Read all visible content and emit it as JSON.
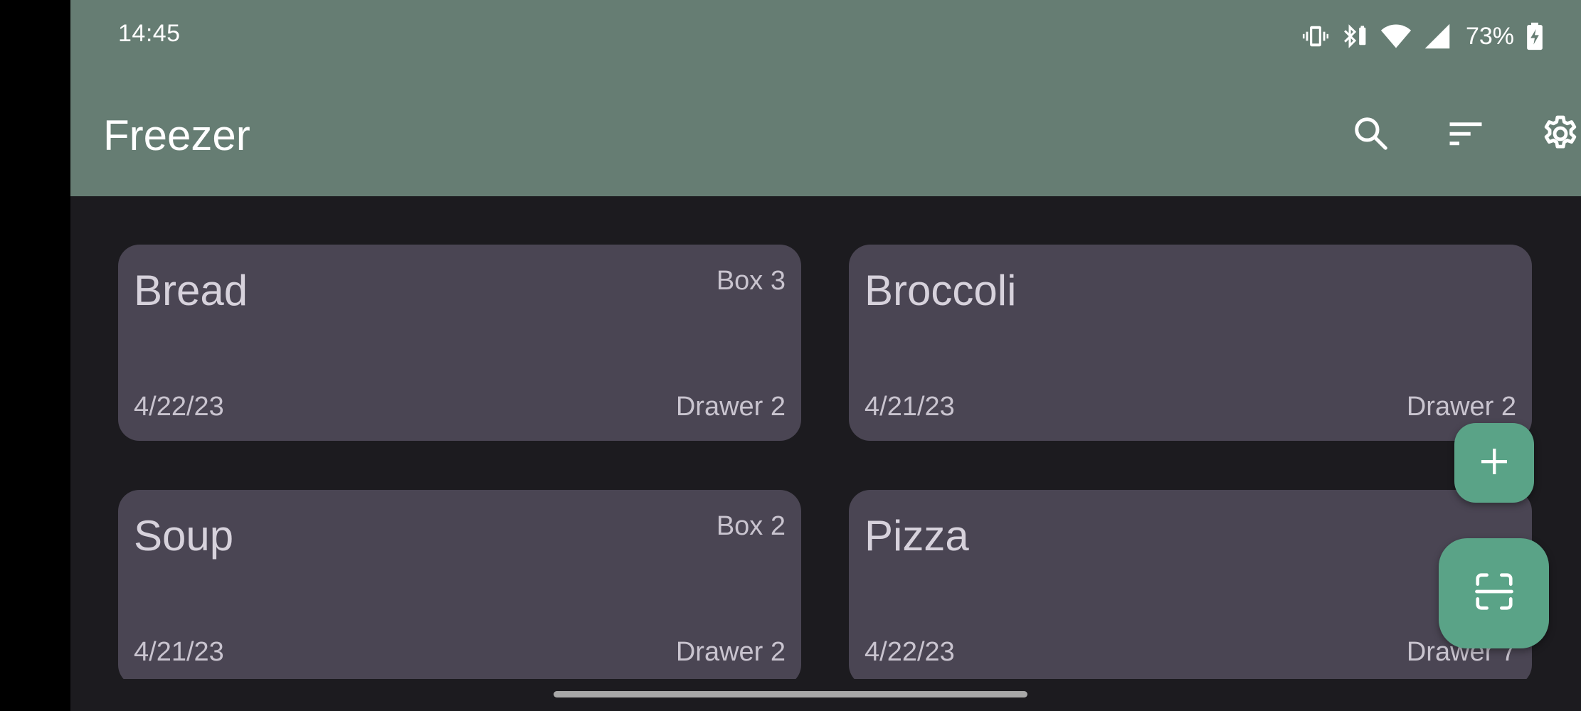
{
  "status_bar": {
    "time": "14:45",
    "battery_percent": "73%",
    "icons": [
      "vibrate-icon",
      "bluetooth-battery-icon",
      "wifi-icon",
      "cell-signal-icon",
      "battery-charging-icon"
    ]
  },
  "app_bar": {
    "title": "Freezer",
    "background_color": "#667d73",
    "actions": [
      "search-icon",
      "sort-icon",
      "settings-icon"
    ]
  },
  "items": [
    {
      "name": "Bread",
      "box": "Box 3",
      "date": "4/22/23",
      "drawer": "Drawer 2"
    },
    {
      "name": "Broccoli",
      "box": "",
      "date": "4/21/23",
      "drawer": "Drawer 2"
    },
    {
      "name": "Soup",
      "box": "Box 2",
      "date": "4/21/23",
      "drawer": "Drawer 2"
    },
    {
      "name": "Pizza",
      "box": "",
      "date": "4/22/23",
      "drawer": "Drawer 7"
    }
  ],
  "fabs": {
    "add_icon": "plus-icon",
    "scan_icon": "scan-icon",
    "color": "#5aa387"
  }
}
